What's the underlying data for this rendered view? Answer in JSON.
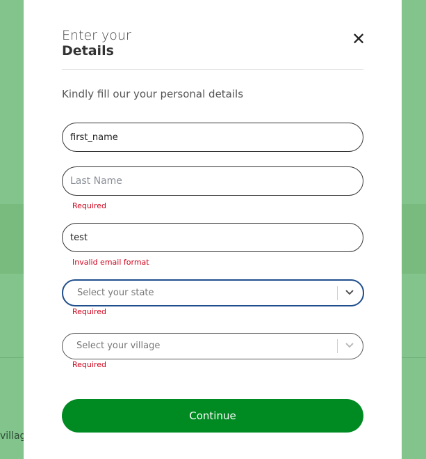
{
  "background": {
    "partial_text": "villag"
  },
  "modal": {
    "title_line1": "Enter your",
    "title_line2": "Details",
    "close_symbol": "✕",
    "subtitle": "Kindly fill our your personal details",
    "fields": {
      "first_name": {
        "value": "first_name",
        "placeholder": ""
      },
      "last_name": {
        "value": "",
        "placeholder": "Last Name",
        "error": "Required"
      },
      "email": {
        "value": "test",
        "placeholder": "",
        "error": "Invalid email format"
      }
    },
    "selects": {
      "state": {
        "placeholder": "Select your state",
        "error": "Required"
      },
      "village": {
        "placeholder": "Select your village",
        "error": "Required"
      }
    },
    "continue_label": "Continue"
  },
  "colors": {
    "backdrop": "#82c48c",
    "primary_button": "#008a22",
    "error": "#d0021b",
    "focus_border": "#1f4e8c"
  },
  "icons": {
    "close": "close-icon",
    "chevron": "chevron-down-icon"
  }
}
